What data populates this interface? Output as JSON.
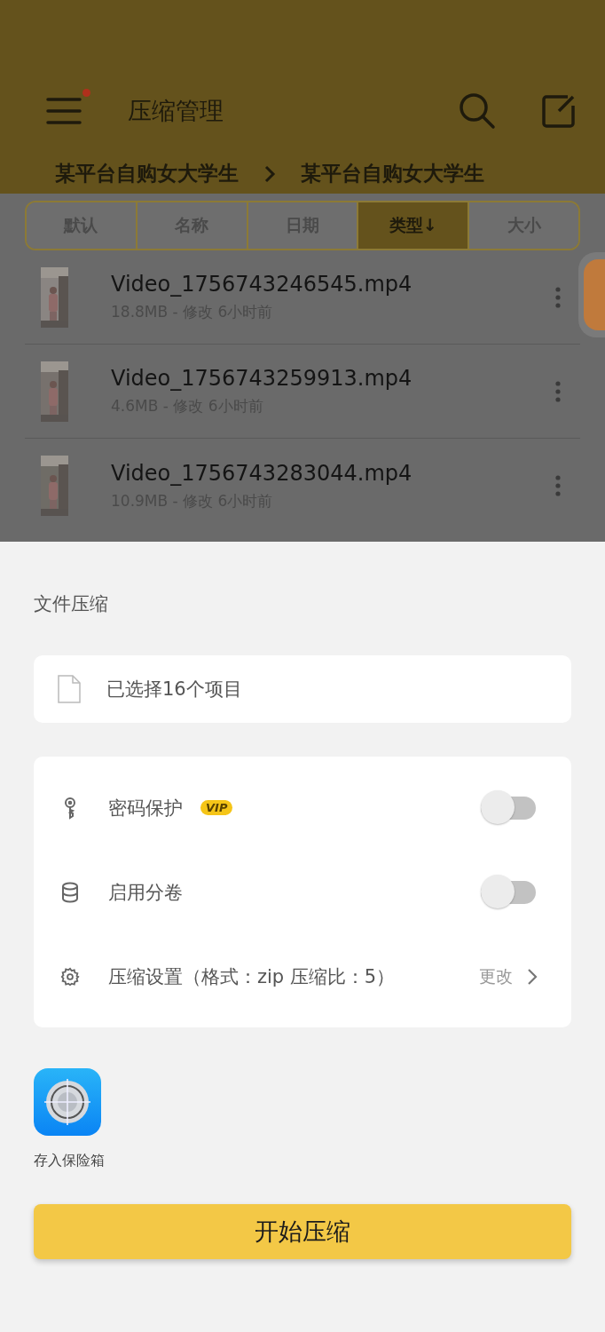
{
  "header": {
    "title": "压缩管理",
    "menu_badge": true
  },
  "breadcrumbs": [
    "某平台自购女大学生",
    "某平台自购女大学生"
  ],
  "sort_tabs": [
    {
      "label": "默认",
      "selected": false
    },
    {
      "label": "名称",
      "selected": false
    },
    {
      "label": "日期",
      "selected": false
    },
    {
      "label": "类型↓",
      "selected": true
    },
    {
      "label": "大小",
      "selected": false
    }
  ],
  "files": [
    {
      "name": "Video_1756743246545.mp4",
      "meta": "18.8MB - 修改 6小时前",
      "kind": "picture"
    },
    {
      "name": "Video_1756743259913.mp4",
      "meta": "4.6MB - 修改 6小时前",
      "kind": "picture"
    },
    {
      "name": "Video_1756743283044.mp4",
      "meta": "10.9MB - 修改 6小时前",
      "kind": "picture"
    }
  ],
  "sheet": {
    "title": "文件压缩",
    "selection": "已选择16个项目",
    "options": [
      {
        "kind": "toggle",
        "label": "密码保护",
        "badge": "VIP",
        "on": false
      },
      {
        "kind": "toggle",
        "label": "启用分卷",
        "on": false
      },
      {
        "kind": "link",
        "label": "压缩设置（格式：zip  压缩比：5）",
        "action": "更改"
      }
    ],
    "vault": {
      "label": "存入保险箱"
    },
    "button": "开始压缩"
  }
}
